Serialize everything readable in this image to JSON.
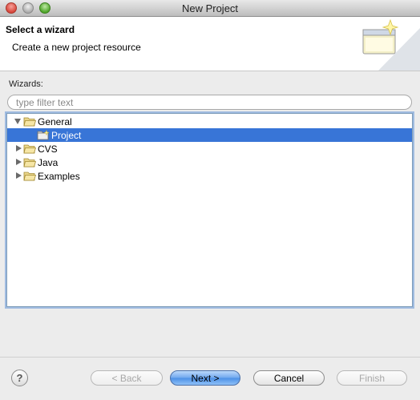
{
  "window": {
    "title": "New Project"
  },
  "header": {
    "title": "Select a wizard",
    "description": "Create a new project resource",
    "art_icon": "wizard-window-sparkle-icon"
  },
  "wizards": {
    "label": "Wizards:",
    "filter_placeholder": "type filter text",
    "filter_value": "",
    "tree": [
      {
        "label": "General",
        "expanded": true,
        "icon": "folder-open-icon"
      },
      {
        "label": "Project",
        "selected": true,
        "icon": "project-icon"
      },
      {
        "label": "CVS",
        "expanded": false,
        "icon": "folder-icon"
      },
      {
        "label": "Java",
        "expanded": false,
        "icon": "folder-icon"
      },
      {
        "label": "Examples",
        "expanded": false,
        "icon": "folder-icon"
      }
    ]
  },
  "footer": {
    "help": "?",
    "back_label": "< Back",
    "next_label": "Next >",
    "cancel_label": "Cancel",
    "finish_label": "Finish"
  },
  "colors": {
    "selection": "#3875d7",
    "focus_ring": "#9fbbe0"
  }
}
